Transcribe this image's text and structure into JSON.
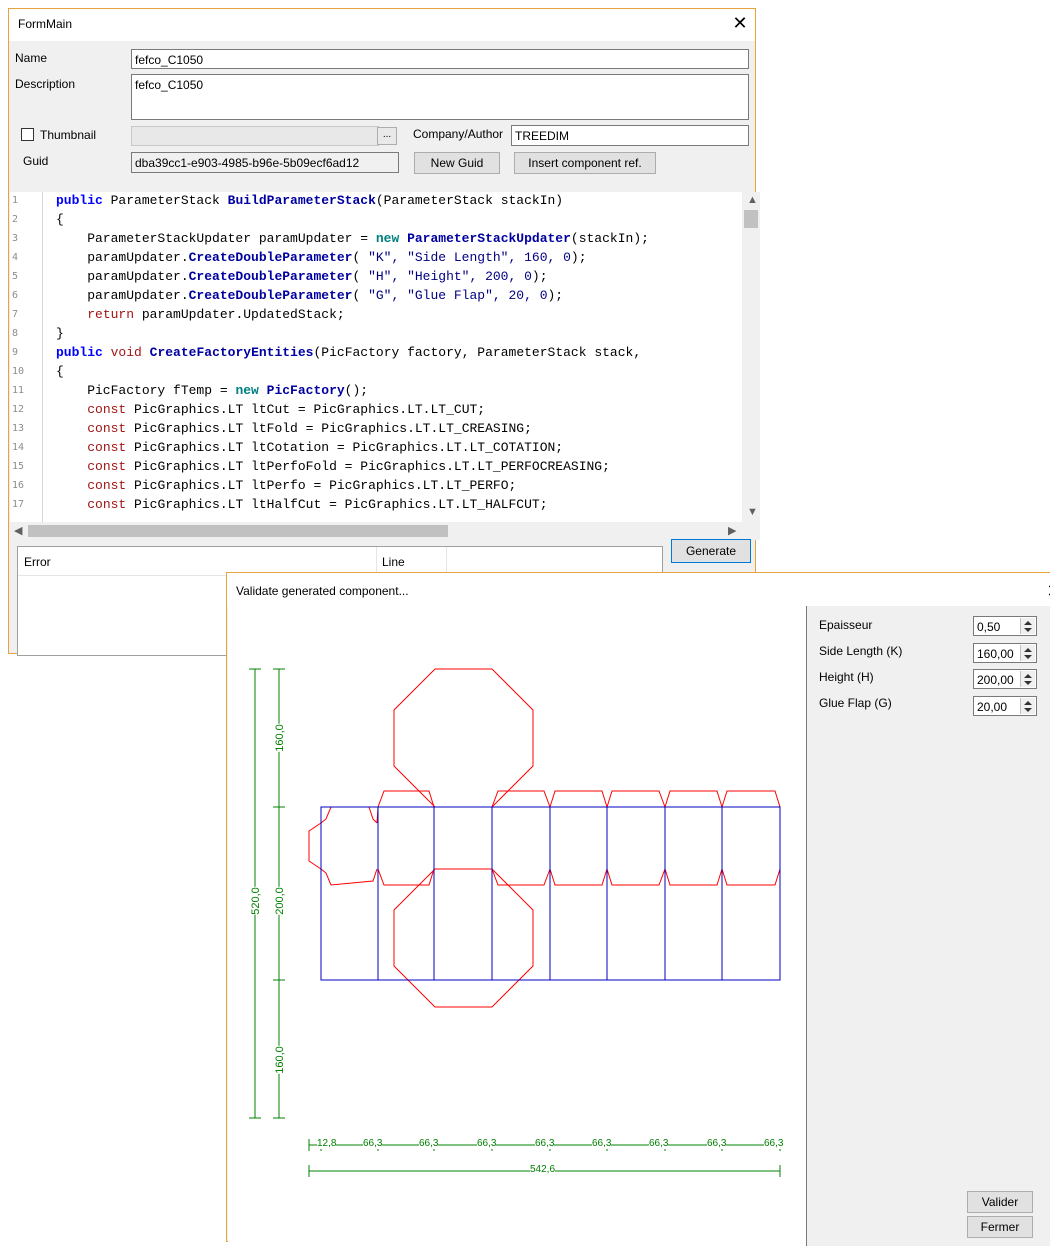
{
  "form_main": {
    "title": "FormMain",
    "name_label": "Name",
    "name_value": "fefco_C1050",
    "description_label": "Description",
    "description_value": "fefco_C1050",
    "thumbnail_label": "Thumbnail",
    "browse_label": "...",
    "company_label": "Company/Author",
    "company_value": "TREEDIM",
    "guid_label": "Guid",
    "guid_value": "dba39cc1-e903-4985-b96e-5b09ecf6ad12",
    "new_guid_label": "New Guid",
    "insert_ref_label": "Insert component ref.",
    "error_col": "Error",
    "line_col": "Line",
    "generate_label": "Generate",
    "line_numbers": [
      "1",
      "2",
      "3",
      "4",
      "5",
      "6",
      "7",
      "8",
      "9",
      "10",
      "11",
      "12",
      "13",
      "14",
      "15",
      "16",
      "17"
    ]
  },
  "validate": {
    "title": "Validate generated component...",
    "params": [
      {
        "label": "Epaisseur",
        "value": "0,50"
      },
      {
        "label": "Side Length (K)",
        "value": "160,00"
      },
      {
        "label": "Height (H)",
        "value": "200,00"
      },
      {
        "label": "Glue Flap (G)",
        "value": "20,00"
      }
    ],
    "valider_label": "Valider",
    "fermer_label": "Fermer"
  },
  "drawing": {
    "dim_total_height": "520,0",
    "dim_top_flap": "160,0",
    "dim_body_height": "200,0",
    "dim_bottom_flap": "160,0",
    "dim_glue": "12,8",
    "dim_panel": "66,3",
    "dim_total_width": "542,6"
  },
  "colors": {
    "cut": "#ff0000",
    "crease": "#0000c0",
    "dimension": "#008000",
    "window_border": "#e8a33c"
  }
}
